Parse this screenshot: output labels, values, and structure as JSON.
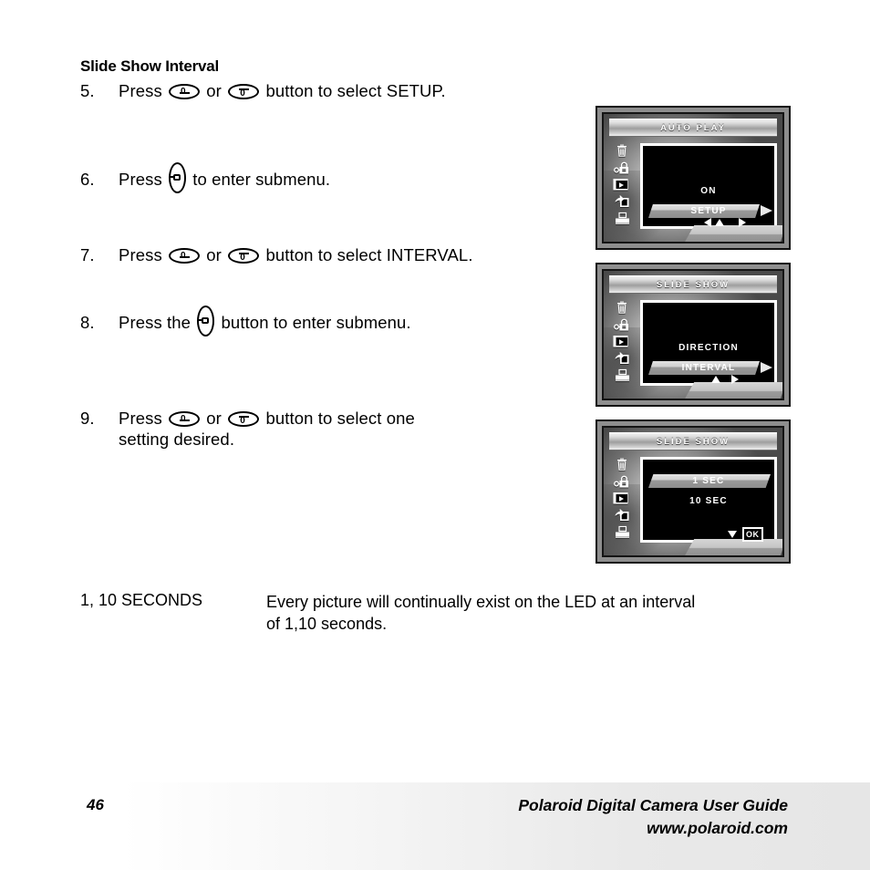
{
  "document": {
    "section_title": "Slide Show Interval"
  },
  "steps": [
    {
      "number": "5.",
      "before": "Press",
      "mid": "or",
      "after": "button to select SETUP.",
      "glyphs": [
        "dial-up-button",
        "dial-down-button"
      ]
    },
    {
      "number": "6.",
      "before": "Press",
      "after": "to enter submenu.",
      "glyphs": [
        "right-arrow-button"
      ]
    },
    {
      "number": "7.",
      "before": "Press",
      "mid": "or",
      "after": "button to select INTERVAL.",
      "glyphs": [
        "dial-up-button",
        "dial-down-button"
      ]
    },
    {
      "number": "8.",
      "before": "Press the",
      "after": "button to enter submenu.",
      "glyphs": [
        "right-arrow-button"
      ]
    },
    {
      "number": "9.",
      "before": "Press",
      "mid": "or",
      "after": "button to select one",
      "continuation": "setting desired.",
      "glyphs": [
        "dial-up-button",
        "dial-down-button"
      ]
    }
  ],
  "glossary": {
    "term": "1, 10 SECONDS",
    "definition_line1": "Every picture will continually exist on the LED at an interval",
    "definition_line2": "of 1,10 seconds."
  },
  "footer": {
    "page_number": "46",
    "guide_title": "Polaroid Digital Camera User Guide",
    "website": "www.polaroid.com"
  },
  "screens": [
    {
      "id": "auto-play",
      "title": "AUTO PLAY",
      "icons": [
        "trash-icon",
        "lock-icon",
        "slideshow-icon",
        "share-icon",
        "printer-icon"
      ],
      "menu_items": [
        {
          "label": "ON",
          "selected": false
        },
        {
          "label": "SETUP",
          "selected": true
        }
      ],
      "hints": [
        "left-arrow",
        "up-arrow",
        "right-arrow"
      ]
    },
    {
      "id": "slide-show-menu",
      "title": "SLIDE SHOW",
      "icons": [
        "trash-icon",
        "lock-icon",
        "slideshow-icon",
        "share-icon",
        "printer-icon"
      ],
      "menu_items": [
        {
          "label": "DIRECTION",
          "selected": false
        },
        {
          "label": "INTERVAL",
          "selected": true
        }
      ],
      "hints": [
        "up-arrow",
        "right-arrow"
      ]
    },
    {
      "id": "slide-show-interval",
      "title": "SLIDE SHOW",
      "icons": [
        "trash-icon",
        "lock-icon",
        "slideshow-icon",
        "share-icon",
        "printer-icon"
      ],
      "menu_items": [
        {
          "label": "1 SEC",
          "selected": true
        },
        {
          "label": "10 SEC",
          "selected": false
        }
      ],
      "hints": [
        "down-arrow",
        "ok-button"
      ],
      "ok_label": "OK"
    }
  ],
  "colors": {
    "osd_background": "#000000",
    "osd_text": "#ffffff",
    "selection_slab": "#cfcfcf",
    "camera_bezel": "#8e8e8e"
  }
}
